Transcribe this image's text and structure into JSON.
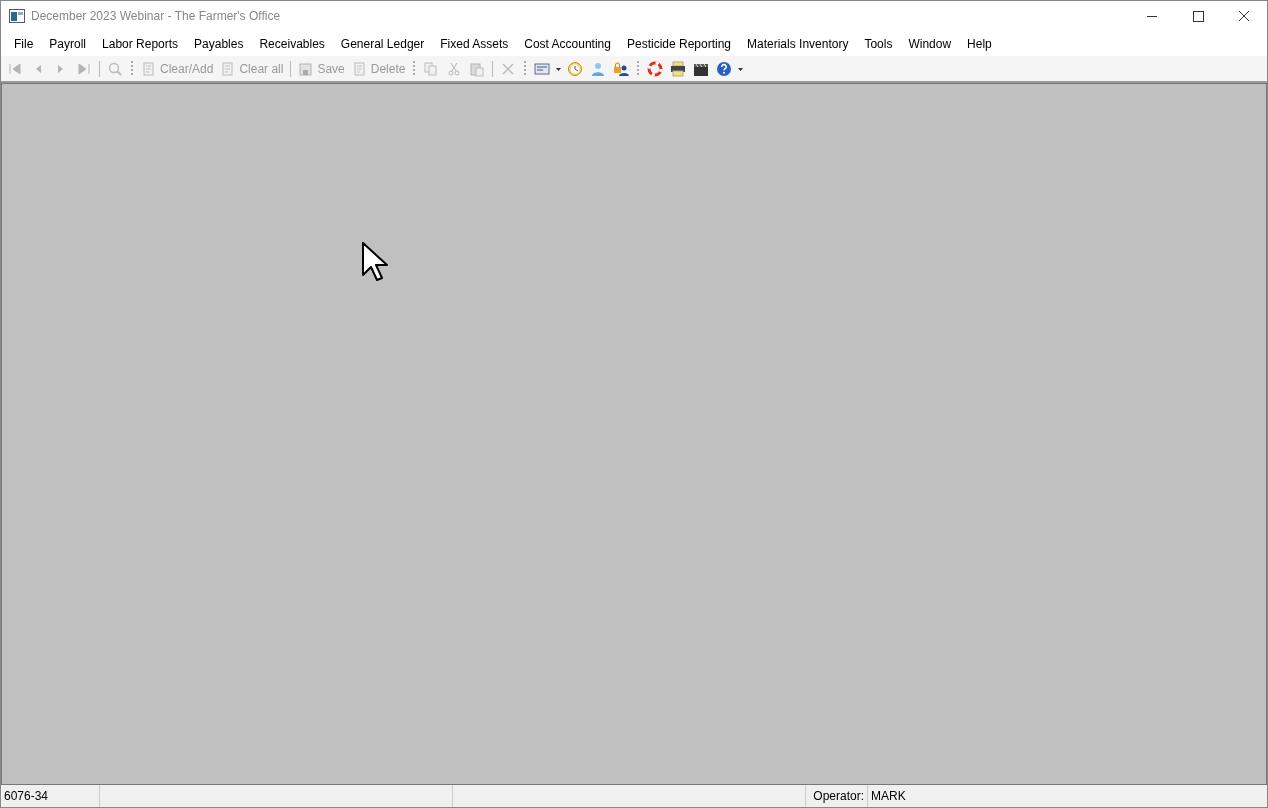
{
  "window": {
    "title": "December 2023 Webinar - The Farmer's Office"
  },
  "menu": [
    "File",
    "Payroll",
    "Labor Reports",
    "Payables",
    "Receivables",
    "General Ledger",
    "Fixed Assets",
    "Cost Accounting",
    "Pesticide Reporting",
    "Materials Inventory",
    "Tools",
    "Window",
    "Help"
  ],
  "toolbar": [
    {
      "kind": "icon",
      "disabled": true
    },
    {
      "kind": "icon",
      "disabled": true
    },
    {
      "kind": "icon",
      "disabled": true
    },
    {
      "kind": "icon",
      "disabled": true
    },
    {
      "kind": "sep"
    },
    {
      "kind": "icon",
      "disabled": true
    },
    {
      "kind": "grip"
    },
    {
      "kind": "button",
      "label": "Clear/Add",
      "disabled": true
    },
    {
      "kind": "button",
      "label": "Clear all",
      "disabled": true
    },
    {
      "kind": "sep"
    },
    {
      "kind": "button",
      "label": "Save",
      "disabled": true
    },
    {
      "kind": "button",
      "label": "Delete",
      "disabled": true
    },
    {
      "kind": "grip"
    },
    {
      "kind": "icon",
      "disabled": true
    },
    {
      "kind": "icon",
      "disabled": true
    },
    {
      "kind": "icon",
      "disabled": true
    },
    {
      "kind": "sep"
    },
    {
      "kind": "icon",
      "disabled": true
    },
    {
      "kind": "grip"
    },
    {
      "kind": "icon",
      "disabled": false
    },
    {
      "kind": "dropdown"
    },
    {
      "kind": "icon",
      "disabled": false
    },
    {
      "kind": "icon",
      "disabled": false
    },
    {
      "kind": "icon",
      "disabled": false
    },
    {
      "kind": "grip"
    },
    {
      "kind": "icon",
      "disabled": false
    },
    {
      "kind": "icon",
      "disabled": false
    },
    {
      "kind": "icon",
      "disabled": false
    },
    {
      "kind": "icon",
      "disabled": false
    },
    {
      "kind": "dropdown"
    }
  ],
  "status_bar": {
    "code": "6076-34",
    "operator_label": "Operator:",
    "operator": "MARK"
  }
}
